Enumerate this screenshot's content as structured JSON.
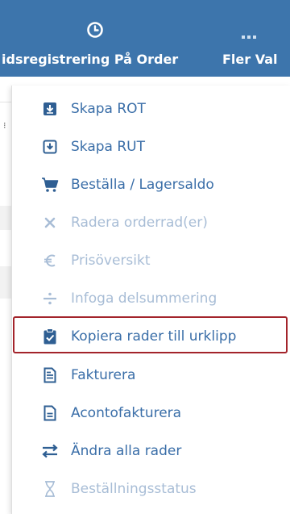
{
  "topbar": {
    "time_label": "idsregistrering På Order",
    "more_label": "Fler Val",
    "time_icon": "clock-icon",
    "more_icon": "ellipsis-icon"
  },
  "menu": {
    "items": [
      {
        "label": "Skapa ROT",
        "icon": "download-box-icon",
        "enabled": true
      },
      {
        "label": "Skapa RUT",
        "icon": "download-box-outline-icon",
        "enabled": true
      },
      {
        "label": "Beställa / Lagersaldo",
        "icon": "cart-icon",
        "enabled": true
      },
      {
        "label": "Radera orderrad(er)",
        "icon": "close-icon",
        "enabled": false
      },
      {
        "label": "Prisöversikt",
        "icon": "euro-icon",
        "enabled": false
      },
      {
        "label": "Infoga delsummering",
        "icon": "divide-icon",
        "enabled": false
      },
      {
        "label": "Kopiera rader till urklipp",
        "icon": "clipboard-check-icon",
        "enabled": true,
        "highlighted": true
      },
      {
        "label": "Fakturera",
        "icon": "invoice-icon",
        "enabled": true
      },
      {
        "label": "Acontofakturera",
        "icon": "file-icon",
        "enabled": true
      },
      {
        "label": "Ändra alla rader",
        "icon": "exchange-arrows-icon",
        "enabled": true
      },
      {
        "label": "Beställningsstatus",
        "icon": "hourglass-icon",
        "enabled": false
      }
    ]
  },
  "colors": {
    "topbar": "#3d75ac",
    "enabled_text": "#3a6ea8",
    "disabled_text": "#a8bdd6",
    "icon": "#2f5f93",
    "highlight_border": "#a3242b"
  }
}
